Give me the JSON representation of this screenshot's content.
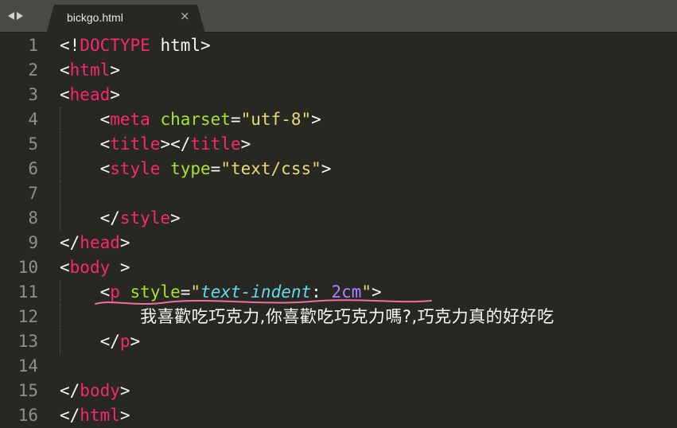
{
  "tab": {
    "title": "bickgo.html",
    "close_glyph": "×"
  },
  "colors": {
    "background": "#272822",
    "tag": "#f92672",
    "attribute": "#a6e22e",
    "string": "#e6db74",
    "css_property": "#66d9ef",
    "number": "#ae81ff",
    "line_number": "#8f908a",
    "annotation_underline": "#f06fa0"
  },
  "icons": {
    "nav": [
      "arrow-left-icon",
      "arrow-right-icon"
    ]
  },
  "lines": [
    {
      "n": "1",
      "t": [
        [
          "p",
          "<!"
        ],
        [
          "tag",
          "DOCTYPE"
        ],
        [
          "p",
          " html>"
        ]
      ]
    },
    {
      "n": "2",
      "t": [
        [
          "p",
          "<"
        ],
        [
          "tag",
          "html"
        ],
        [
          "p",
          ">"
        ]
      ]
    },
    {
      "n": "3",
      "t": [
        [
          "p",
          "<"
        ],
        [
          "tag",
          "head"
        ],
        [
          "p",
          ">"
        ]
      ]
    },
    {
      "n": "4",
      "t": [
        [
          "p",
          "    <"
        ],
        [
          "tag",
          "meta"
        ],
        [
          "p",
          " "
        ],
        [
          "attr",
          "charset"
        ],
        [
          "p",
          "="
        ],
        [
          "str",
          "\"utf-8\""
        ],
        [
          "p",
          ">"
        ]
      ]
    },
    {
      "n": "5",
      "t": [
        [
          "p",
          "    <"
        ],
        [
          "tag",
          "title"
        ],
        [
          "p",
          "></"
        ],
        [
          "tag",
          "title"
        ],
        [
          "p",
          ">"
        ]
      ]
    },
    {
      "n": "6",
      "t": [
        [
          "p",
          "    <"
        ],
        [
          "tag",
          "style"
        ],
        [
          "p",
          " "
        ],
        [
          "attr",
          "type"
        ],
        [
          "p",
          "="
        ],
        [
          "str",
          "\"text/css\""
        ],
        [
          "p",
          ">"
        ]
      ]
    },
    {
      "n": "7",
      "t": []
    },
    {
      "n": "8",
      "t": [
        [
          "p",
          "    </"
        ],
        [
          "tag",
          "style"
        ],
        [
          "p",
          ">"
        ]
      ]
    },
    {
      "n": "9",
      "t": [
        [
          "p",
          "</"
        ],
        [
          "tag",
          "head"
        ],
        [
          "p",
          ">"
        ]
      ]
    },
    {
      "n": "10",
      "t": [
        [
          "p",
          "<"
        ],
        [
          "tag",
          "body"
        ],
        [
          "p",
          " >"
        ]
      ]
    },
    {
      "n": "11",
      "t": [
        [
          "p",
          "    <"
        ],
        [
          "tag",
          "p"
        ],
        [
          "p",
          " "
        ],
        [
          "attr",
          "style"
        ],
        [
          "p",
          "="
        ],
        [
          "str",
          "\""
        ],
        [
          "prop",
          "text-indent"
        ],
        [
          "p",
          ": "
        ],
        [
          "num",
          "2cm"
        ],
        [
          "str",
          "\""
        ],
        [
          "p",
          ">"
        ]
      ]
    },
    {
      "n": "12",
      "t": [
        [
          "p",
          "        "
        ],
        [
          "cjk",
          "我喜歡吃巧克力,你喜歡吃巧克力嗎?,巧克力真的好好吃"
        ]
      ]
    },
    {
      "n": "13",
      "t": [
        [
          "p",
          "    </"
        ],
        [
          "tag",
          "p"
        ],
        [
          "p",
          ">"
        ]
      ]
    },
    {
      "n": "14",
      "t": []
    },
    {
      "n": "15",
      "t": [
        [
          "p",
          "</"
        ],
        [
          "tag",
          "body"
        ],
        [
          "p",
          ">"
        ]
      ]
    },
    {
      "n": "16",
      "t": [
        [
          "p",
          "</"
        ],
        [
          "tag",
          "html"
        ],
        [
          "p",
          ">"
        ]
      ]
    }
  ]
}
